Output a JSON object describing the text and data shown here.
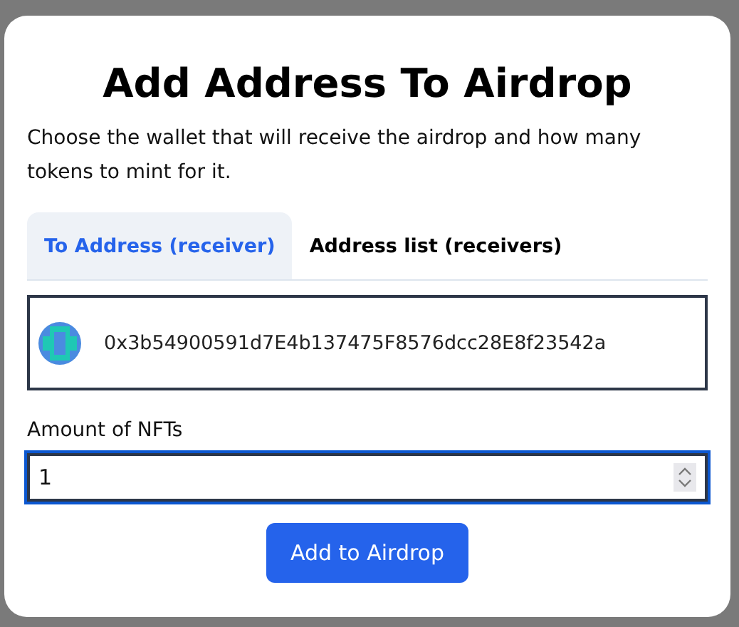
{
  "dialog": {
    "title": "Add Address To Airdrop",
    "description": "Choose the wallet that will receive the airdrop and how many tokens to mint for it."
  },
  "tabs": [
    {
      "label": "To Address (receiver)",
      "selected": true
    },
    {
      "label": "Address list (receivers)",
      "selected": false
    }
  ],
  "wallet": {
    "address": "0x3b54900591d7E4b137475F8576dcc28E8f23542a"
  },
  "amount": {
    "label": "Amount of NFTs",
    "value": "1"
  },
  "submit": {
    "label": "Add to Airdrop"
  }
}
